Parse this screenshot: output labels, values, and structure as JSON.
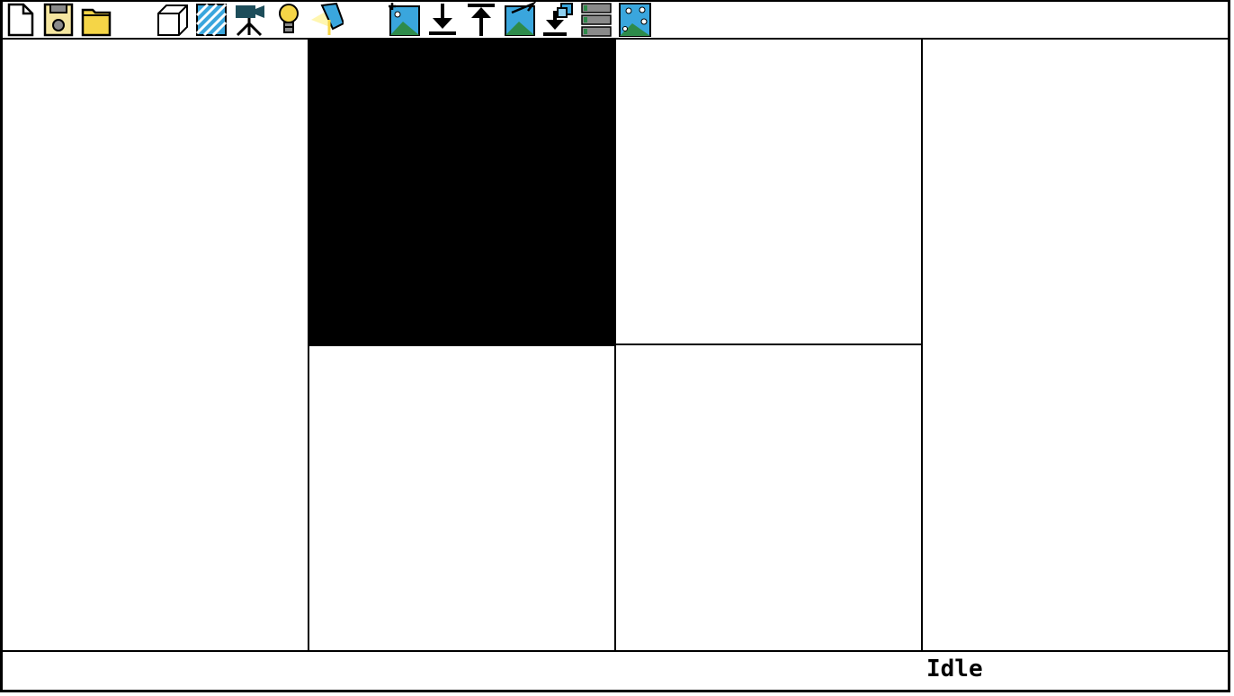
{
  "toolbar": {
    "buttons": [
      {
        "name": "new-file",
        "icon": "new-file-icon"
      },
      {
        "name": "save",
        "icon": "save-disk-icon"
      },
      {
        "name": "open-folder",
        "icon": "folder-icon"
      },
      {
        "name": "cube",
        "icon": "cube-icon"
      },
      {
        "name": "texture",
        "icon": "hatched-texture-icon"
      },
      {
        "name": "camera",
        "icon": "movie-camera-icon"
      },
      {
        "name": "light",
        "icon": "light-bulb-icon"
      },
      {
        "name": "spotlight",
        "icon": "spotlight-icon"
      },
      {
        "name": "add-image",
        "icon": "image-add-icon"
      },
      {
        "name": "import",
        "icon": "arrow-down-icon"
      },
      {
        "name": "export",
        "icon": "arrow-up-icon"
      },
      {
        "name": "render-image",
        "icon": "image-render-icon"
      },
      {
        "name": "import-layers",
        "icon": "import-layers-icon"
      },
      {
        "name": "list-layers",
        "icon": "layers-list-icon"
      },
      {
        "name": "gallery",
        "icon": "landscape-sparkle-icon"
      }
    ]
  },
  "colors": {
    "frame": "#000000",
    "background": "#ffffff",
    "active_pane": "#000000",
    "icon_blue": "#3aa6dd",
    "icon_green": "#2e8b4a",
    "icon_yellow": "#f5d547",
    "icon_gray": "#8a8a8a",
    "icon_darkteal": "#1d4d5a"
  },
  "status": {
    "text": "Idle"
  }
}
